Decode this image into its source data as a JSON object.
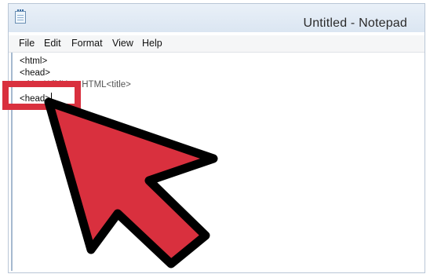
{
  "window": {
    "title": "Untitled - Notepad"
  },
  "menu": {
    "items": [
      "File",
      "Edit",
      "Format",
      "View",
      "Help"
    ]
  },
  "editor": {
    "lines": [
      "<html>",
      "<head>",
      "<title>WikiHow HTML<title>",
      "<head>"
    ]
  },
  "colors": {
    "highlight": "#d9303e",
    "arrow_fill": "#d9303e",
    "arrow_outline": "#000000"
  },
  "icons": {
    "app": "notepad-icon",
    "pointer": "arrow-pointer-icon"
  }
}
